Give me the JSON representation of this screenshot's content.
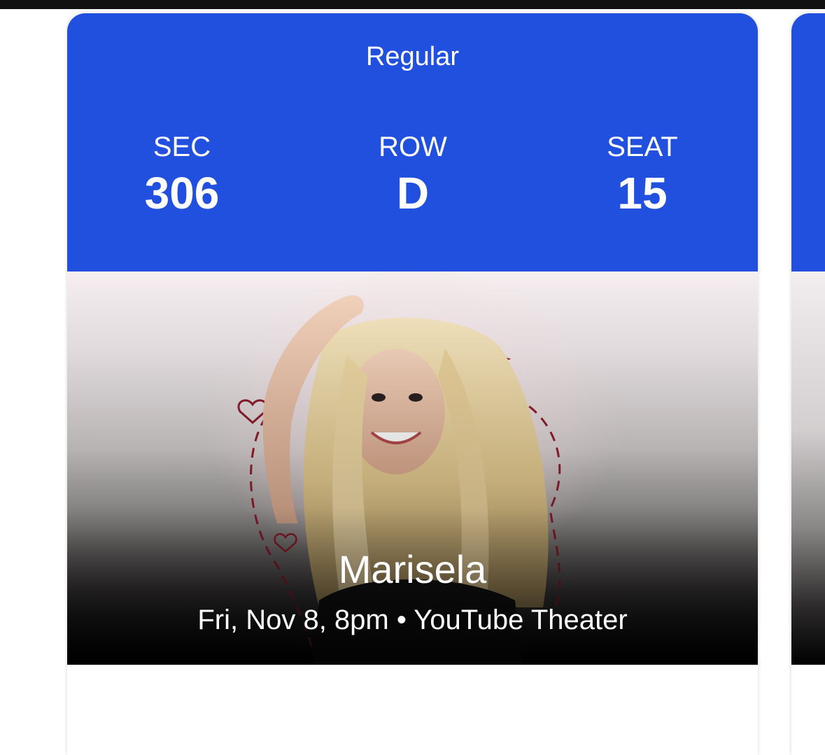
{
  "ticket": {
    "type": "Regular",
    "section": {
      "label": "SEC",
      "value": "306"
    },
    "row": {
      "label": "ROW",
      "value": "D"
    },
    "seat": {
      "label": "SEAT",
      "value": "15"
    },
    "event": {
      "name": "Marisela",
      "details": "Fri, Nov 8, 8pm • YouTube Theater"
    },
    "image": {
      "icon": "artist-photo"
    }
  },
  "colors": {
    "header_blue": "#2150de",
    "text_white": "#ffffff",
    "heart_red": "#8e1d2c"
  }
}
